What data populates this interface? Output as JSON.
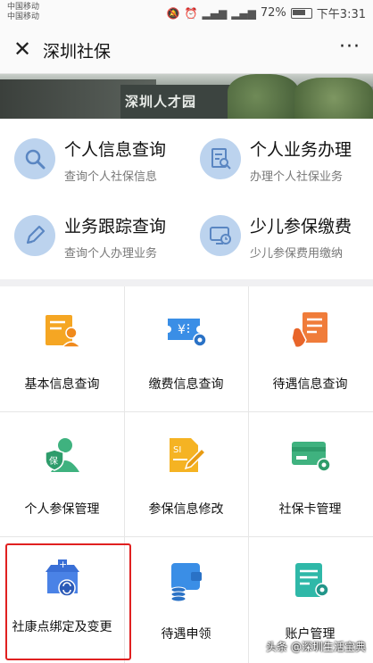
{
  "status_bar": {
    "carrier1": "中国移动",
    "carrier2": "中国移动",
    "battery": "72%",
    "time": "下午3:31"
  },
  "titlebar": {
    "title": "深圳社保",
    "more": "···"
  },
  "banner": {
    "sign_text": "深圳人才园"
  },
  "quick_items": [
    {
      "title": "个人信息查询",
      "subtitle": "查询个人社保信息",
      "icon": "search-icon"
    },
    {
      "title": "个人业务办理",
      "subtitle": "办理个人社保业务",
      "icon": "document-search-icon"
    },
    {
      "title": "业务跟踪查询",
      "subtitle": "查询个人办理业务",
      "icon": "pencil-icon"
    },
    {
      "title": "少儿参保缴费",
      "subtitle": "少儿参保费用缴纳",
      "icon": "monitor-clock-icon"
    }
  ],
  "grid_items": [
    {
      "label": "基本信息查询",
      "icon": "profile-document-icon",
      "color": "#f5a623"
    },
    {
      "label": "缴费信息查询",
      "icon": "yuan-ticket-icon",
      "color": "#3a8ee6"
    },
    {
      "label": "待遇信息查询",
      "icon": "hand-document-icon",
      "color": "#f07c3a"
    },
    {
      "label": "个人参保管理",
      "icon": "insured-person-icon",
      "color": "#3fb27f"
    },
    {
      "label": "参保信息修改",
      "icon": "edit-document-icon",
      "color": "#f5b323"
    },
    {
      "label": "社保卡管理",
      "icon": "card-gear-icon",
      "color": "#3fb27f"
    },
    {
      "label": "社康点绑定及变更",
      "icon": "clinic-switch-icon",
      "color": "#3a6fd6"
    },
    {
      "label": "待遇申领",
      "icon": "wallet-coins-icon",
      "color": "#3a8ee6"
    },
    {
      "label": "账户管理",
      "icon": "account-gear-icon",
      "color": "#2fb8a8"
    }
  ],
  "watermark": "头条 @深圳生活宝典"
}
